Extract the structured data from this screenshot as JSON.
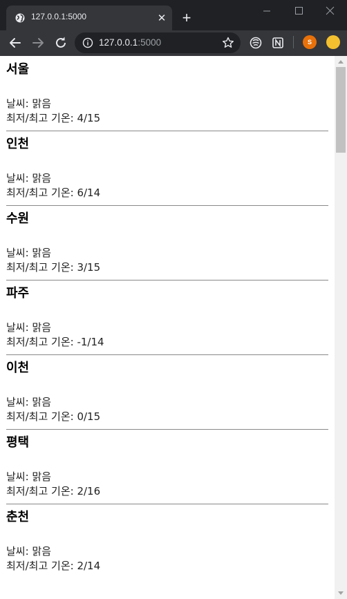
{
  "browser": {
    "tab_title": "127.0.0.1:5000",
    "tab_close": "✕",
    "new_tab": "+",
    "url_host": "127.0.0.1",
    "url_port": ":5000",
    "profile_initial": "S"
  },
  "icons": {
    "favicon": "globe-icon",
    "back": "arrow-left-icon",
    "forward": "arrow-right-icon",
    "reload": "reload-icon",
    "info": "info-icon",
    "bookmark": "star-icon",
    "extension_1": "extension-icon",
    "extension_2": "notion-icon"
  },
  "colors": {
    "chrome_dark": "#202124",
    "toolbar": "#35363a",
    "page_bg": "#ffffff",
    "divider": "#888888",
    "profile": "#e8710a",
    "profile_2": "#f4c02f"
  },
  "cities": [
    {
      "name": "서울",
      "weather": "날씨: 맑음",
      "temp": "최저/최고 기온: 4/15"
    },
    {
      "name": "인천",
      "weather": "날씨: 맑음",
      "temp": "최저/최고 기온: 6/14"
    },
    {
      "name": "수원",
      "weather": "날씨: 맑음",
      "temp": "최저/최고 기온: 3/15"
    },
    {
      "name": "파주",
      "weather": "날씨: 맑음",
      "temp": "최저/최고 기온: -1/14"
    },
    {
      "name": "이천",
      "weather": "날씨: 맑음",
      "temp": "최저/최고 기온: 0/15"
    },
    {
      "name": "평택",
      "weather": "날씨: 맑음",
      "temp": "최저/최고 기온: 2/16"
    },
    {
      "name": "춘천",
      "weather": "날씨: 맑음",
      "temp": "최저/최고 기온: 2/14"
    }
  ]
}
